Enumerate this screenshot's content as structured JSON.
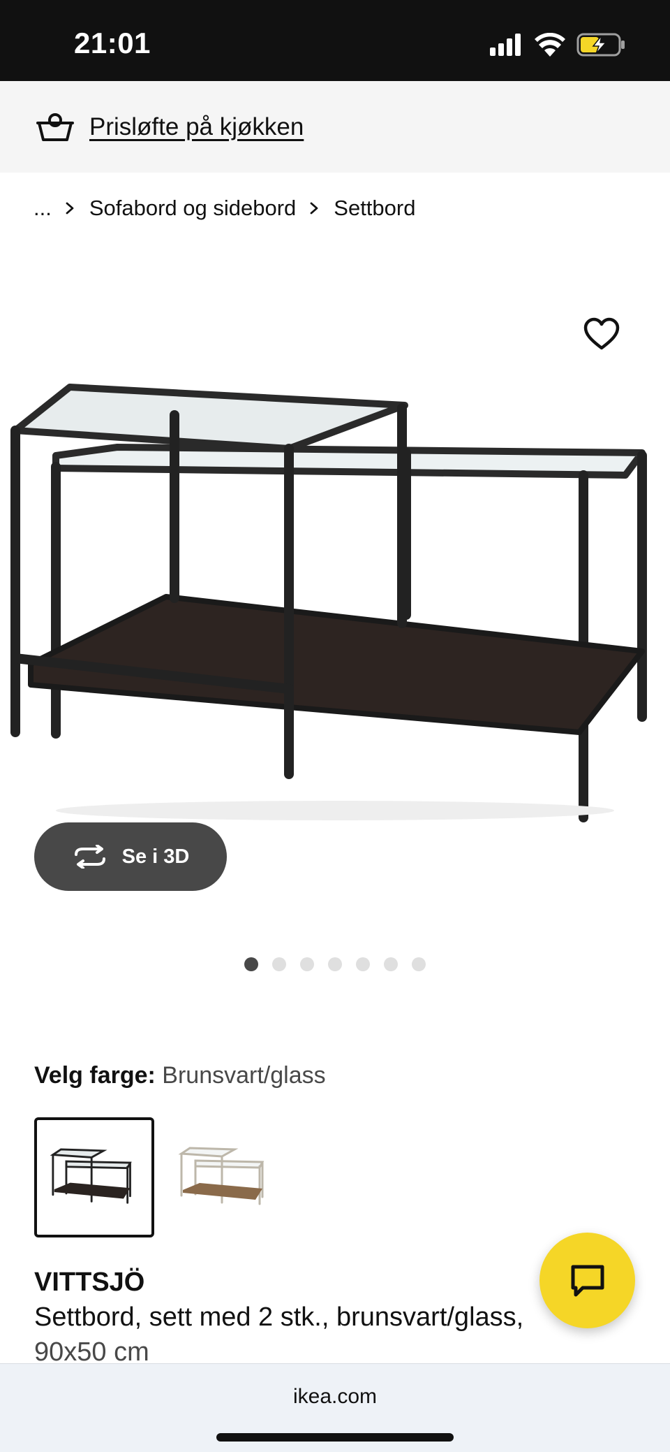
{
  "status_bar": {
    "time": "21:01",
    "icons": [
      "cellular-signal-icon",
      "wifi-icon",
      "battery-charging-icon"
    ],
    "battery_color": "#f5d627"
  },
  "promo": {
    "icon": "basket-icon",
    "link_text": "Prisløfte på kjøkken"
  },
  "breadcrumb": {
    "items": [
      "...",
      "Sofabord og sidebord",
      "Settbord"
    ]
  },
  "gallery": {
    "favourite_icon": "heart-icon",
    "view_3d_label": "Se i 3D",
    "view_3d_icon": "rotate-3d-icon",
    "slide_count": 7,
    "active_slide": 1
  },
  "color_select": {
    "label": "Velg farge:",
    "value": "Brunsvart/glass",
    "options": [
      "black-brown-glass-swatch",
      "white-beige-glass-swatch"
    ],
    "selected_index": 0
  },
  "product": {
    "name": "VITTSJÖ",
    "description": "Settbord, sett med 2 stk., brunsvart/glass,",
    "size": "90x50 cm"
  },
  "chat": {
    "icon": "chat-icon",
    "color": "#f5d627"
  },
  "browser": {
    "url": "ikea.com"
  }
}
